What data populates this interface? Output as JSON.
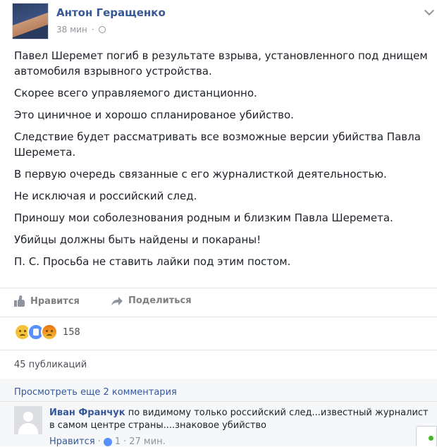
{
  "post": {
    "author": "Антон Геращенко",
    "time": "38 мин",
    "privacy_icon": "globe-icon",
    "paragraphs": [
      "Павел Шеремет погиб в результате взрыва, установленного под днищем автомобиля взрывного устройства.",
      "Скорее всего управляемого дистанционно.",
      "Это циничное и хорошо спланированое убийство.",
      "Следствие будет рассматривать все возможные версии убийства Павла Шеремета.",
      "В первую очередь связанные с его журналисткой деятельностью.",
      "Не исключая и российский след.",
      "Приношу мои соболезнования родным и близким Павла Шеремета.",
      "Убийцы должны быть найдены и покараны!",
      "П. С. Просьба не ставить лайки под этим постом."
    ]
  },
  "actions": {
    "like_label": "Нравится",
    "share_label": "Поделиться"
  },
  "reactions": {
    "count": "158",
    "icons": [
      "sad-reaction-icon",
      "like-reaction-icon",
      "angry-reaction-icon"
    ]
  },
  "shares": {
    "label": "45 публикаций"
  },
  "comments": {
    "more_label": "Просмотреть еще 2 комментария",
    "items": [
      {
        "author": "Иван Франчук",
        "text": "по видимому только российский след...известный журналист в самом центре страны....знаковое убийство",
        "like_label": "Нравится",
        "likes": "1",
        "time": "27 мин."
      }
    ]
  },
  "colors": {
    "link": "#365899",
    "secondary_text": "#90949c",
    "like_reaction": "#5890ff",
    "online": "#42b72a"
  }
}
